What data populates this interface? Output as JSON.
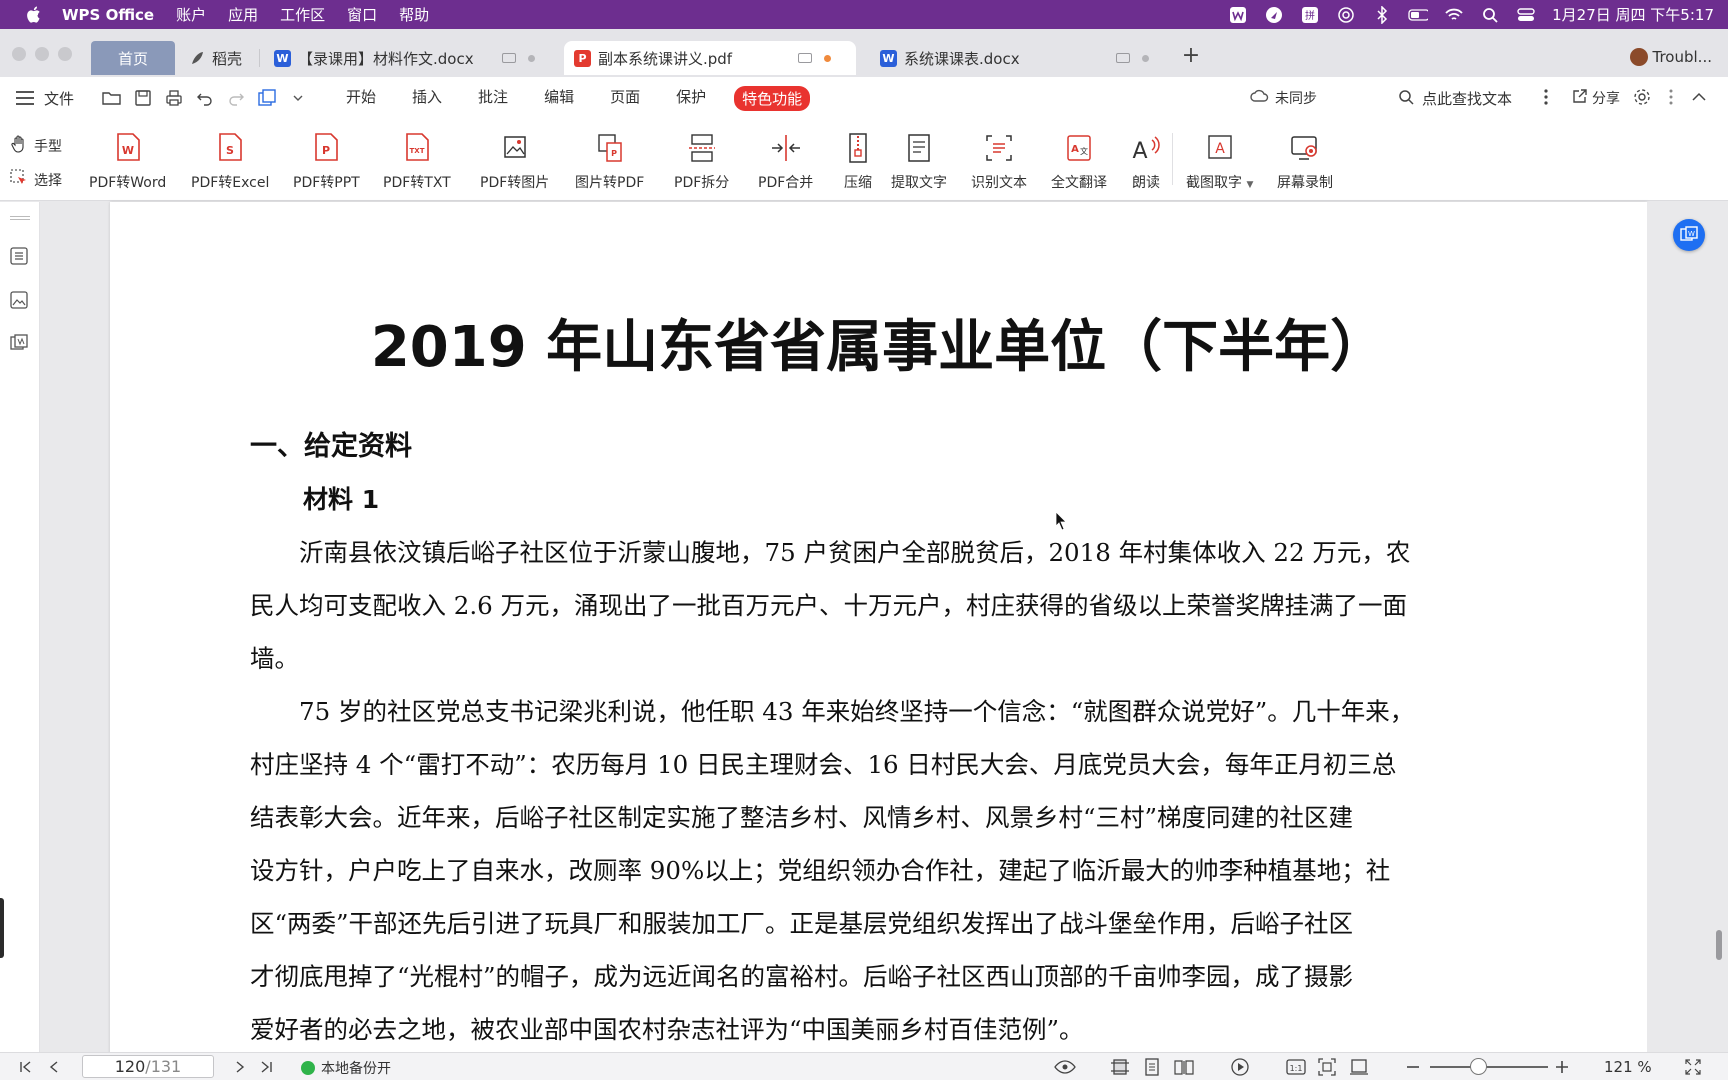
{
  "menubar": {
    "app_name": "WPS Office",
    "items": [
      "账户",
      "应用",
      "工作区",
      "窗口",
      "帮助"
    ],
    "datetime": "1月27日 周四 下午5:17"
  },
  "tabs": {
    "home": "首页",
    "daoke": "稻壳",
    "doc1": "【录课用】材料作文.docx",
    "doc2": "副本系统课讲义.pdf",
    "doc3": "系统课课表.docx",
    "account": "Troubl..."
  },
  "menu": {
    "file": "文件",
    "tabs": [
      "开始",
      "插入",
      "批注",
      "编辑",
      "页面",
      "保护"
    ],
    "special": "特色功能",
    "sync": "未同步",
    "find": "点此查找文本",
    "share": "分享"
  },
  "ribbon": {
    "hand": "手型",
    "select": "选择",
    "buttons": [
      "PDF转Word",
      "PDF转Excel",
      "PDF转PPT",
      "PDF转TXT",
      "PDF转图片",
      "图片转PDF",
      "PDF拆分",
      "PDF合并",
      "压缩",
      "提取文字",
      "识别文本",
      "全文翻译",
      "朗读",
      "截图取字",
      "屏幕录制"
    ]
  },
  "document": {
    "title": "2019 年山东省省属事业单位（下半年）",
    "section": "一、给定资料",
    "subsection": "材料 1",
    "para1": [
      "　　沂南县依汶镇后峪子社区位于沂蒙山腹地，75 户贫困户全部脱贫后，2018 年村集体收入 22 万元，农",
      "民人均可支配收入 2.6 万元，涌现出了一批百万元户、十万元户，村庄获得的省级以上荣誉奖牌挂满了一面",
      "墙。"
    ],
    "para2": [
      "　　75 岁的社区党总支书记梁兆利说，他任职 43 年来始终坚持一个信念：“就图群众说党好”。几十年来，",
      "村庄坚持 4 个“雷打不动”：农历每月 10 日民主理财会、16 日村民大会、月底党员大会，每年正月初三总",
      "结表彰大会。近年来，后峪子社区制定实施了整洁乡村、风情乡村、风景乡村“三村”梯度同建的社区建",
      "设方针，户户吃上了自来水，改厕率 90%以上；党组织领办合作社，建起了临沂最大的帅李种植基地；社",
      "区“两委”干部还先后引进了玩具厂和服装加工厂。正是基层党组织发挥出了战斗堡垒作用，后峪子社区",
      "才彻底甩掉了“光棍村”的帽子，成为远近闻名的富裕村。后峪子社区西山顶部的千亩帅李园，成了摄影",
      "爱好者的必去之地，被农业部中国农村杂志社评为“中国美丽乡村百佳范例”。"
    ]
  },
  "status": {
    "page_current": "120",
    "page_total": "/131",
    "backup": "本地备份开",
    "zoom": "121 %",
    "zoom_fraction": 0.41
  },
  "colors": {
    "menubar": "#6d2e8f",
    "special_tab": "#e9332f",
    "float_button": "#1e6ff2",
    "backup_dot": "#2fb34a"
  }
}
